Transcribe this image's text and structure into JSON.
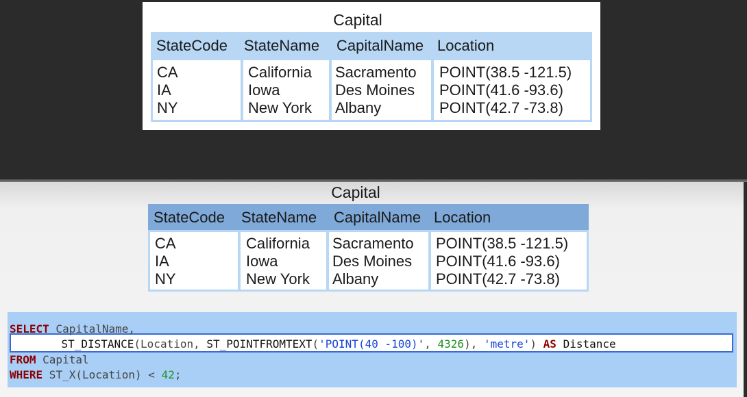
{
  "top_table": {
    "title": "Capital",
    "columns": [
      "StateCode",
      "StateName",
      "CapitalName",
      "Location"
    ],
    "rows": [
      [
        "CA",
        "California",
        "Sacramento",
        "POINT(38.5 -121.5)"
      ],
      [
        "IA",
        "Iowa",
        "Des Moines",
        "POINT(41.6 -93.6)"
      ],
      [
        "NY",
        "New York",
        "Albany",
        "POINT(42.7 -73.8)"
      ]
    ],
    "header_color": "#b7d7f5"
  },
  "bottom_table": {
    "title": "Capital",
    "columns": [
      "StateCode",
      "StateName",
      "CapitalName",
      "Location"
    ],
    "rows": [
      [
        "CA",
        "California",
        "Sacramento",
        "POINT(38.5 -121.5)"
      ],
      [
        "IA",
        "Iowa",
        "Des Moines",
        "POINT(41.6 -93.6)"
      ],
      [
        "NY",
        "New York",
        "Albany",
        "POINT(42.7 -73.8)"
      ]
    ],
    "header_color": "#7fa9d8"
  },
  "sql": {
    "line1_kw": "SELECT",
    "line1_rest": " CapitalName,",
    "line2_fn1": "ST_DISTANCE",
    "line2_a": "(Location, ",
    "line2_fn2": "ST_POINTFROMTEXT",
    "line2_b": "(",
    "line2_str1": "'POINT(40 -100)'",
    "line2_c": ", ",
    "line2_num": "4326",
    "line2_d": "), ",
    "line2_str2": "'metre'",
    "line2_e": ") ",
    "line2_kw": "AS",
    "line2_f": " Distance",
    "line3_kw": "FROM",
    "line3_rest": " Capital",
    "line4_kw": "WHERE",
    "line4_fn": " ST_X",
    "line4_a": "(Location) < ",
    "line4_num": "42",
    "line4_b": ";"
  },
  "colors": {
    "background_dark": "#2b2b2b",
    "sql_highlight": "#a9cff6",
    "keyword": "#8b0000",
    "string": "#1a44d8",
    "number": "#1f8f1f"
  }
}
